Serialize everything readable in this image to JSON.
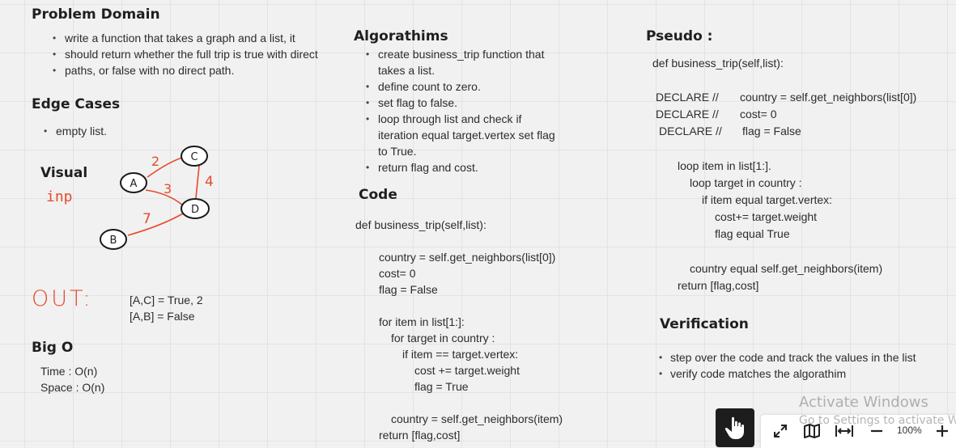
{
  "problem_domain": {
    "heading": "Problem Domain",
    "lines": [
      "write a function that takes a graph and a list, it",
      "should return whether the full trip is true with direct",
      "paths, or false with no direct path."
    ]
  },
  "edge_cases": {
    "heading": "Edge Cases",
    "items": [
      "empty list."
    ]
  },
  "visual": {
    "heading": "Visual",
    "input_label": "inp",
    "nodes": [
      "A",
      "B",
      "C",
      "D"
    ],
    "weights": [
      "2",
      "3",
      "4",
      "7"
    ]
  },
  "output": {
    "label": "OUT:",
    "lines": [
      "[A,C] = True, 2",
      "[A,B] = False"
    ]
  },
  "big_o": {
    "heading": "Big O",
    "time": "Time : O(n)",
    "space": "Space : O(n)"
  },
  "algorithms": {
    "heading": "Algorathims",
    "items": [
      [
        "create business_trip function that",
        "takes a list."
      ],
      [
        "define count to zero."
      ],
      [
        "set flag to false."
      ],
      [
        "loop through list and check if",
        "iteration equal target.vertex set flag",
        "to True."
      ],
      [
        "return flag and cost."
      ]
    ]
  },
  "code": {
    "heading": "Code",
    "lines": [
      "def business_trip(self,list):",
      "country = self.get_neighbors(list[0])",
      "cost= 0",
      "flag = False",
      "for item in list[1:]:",
      "for target in country :",
      "if item == target.vertex:",
      "cost += target.weight",
      "flag = True",
      "country = self.get_neighbors(item)",
      "return [flag,cost]"
    ]
  },
  "pseudo": {
    "heading": "Pseudo :",
    "lines": [
      "def business_trip(self,list):",
      "DECLARE //",
      "country = self.get_neighbors(list[0])",
      "DECLARE //",
      "cost= 0",
      "DECLARE //",
      "flag = False",
      "loop item in list[1:].",
      "loop target in country :",
      "if item equal target.vertex:",
      "cost+= target.weight",
      "flag equal True",
      "country equal self.get_neighbors(item)",
      "return [flag,cost]"
    ]
  },
  "verification": {
    "heading": "Verification",
    "items": [
      "step over the code and track the values in the list",
      "verify code matches the algorathim"
    ]
  },
  "watermark": {
    "title": "Activate Windows",
    "subtitle": "Go to Settings to activate Windows."
  },
  "toolbar": {
    "zoom": "100%",
    "icons": [
      "hand-icon",
      "fullscreen-icon",
      "map-icon",
      "fit-width-icon",
      "zoom-out-icon",
      "zoom-in-icon"
    ]
  },
  "colors": {
    "background": "#f1f1f1",
    "grid": "#e3e3e3",
    "ink_red": "#e54b2c",
    "toolbar_dark": "#1d1d1d"
  }
}
